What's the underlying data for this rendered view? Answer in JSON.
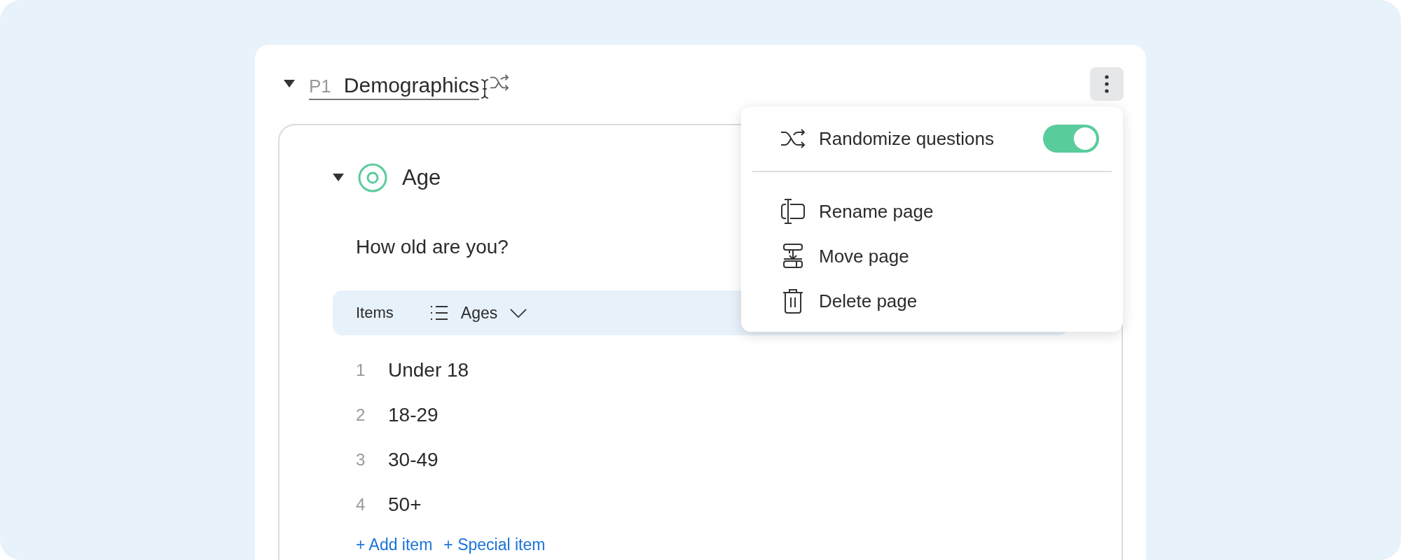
{
  "page": {
    "expanded": true,
    "number": "P1",
    "title": "Demographics",
    "randomized": true
  },
  "menu": {
    "items": [
      {
        "kind": "toggle",
        "label": "Randomize questions",
        "on": true
      },
      {
        "kind": "divider"
      },
      {
        "kind": "rename",
        "label": "Rename page"
      },
      {
        "kind": "move",
        "label": "Move page"
      },
      {
        "kind": "delete",
        "label": "Delete page"
      }
    ]
  },
  "question": {
    "expanded": true,
    "title": "Age",
    "text": "How old are you?",
    "items_bar": {
      "label": "Items",
      "list": "Ages"
    },
    "items": [
      {
        "number": "1",
        "label": "Under 18"
      },
      {
        "number": "2",
        "label": "18-29"
      },
      {
        "number": "3",
        "label": "30-49"
      },
      {
        "number": "4",
        "label": "50+"
      }
    ],
    "links": [
      "+ Add item",
      "+ Special item"
    ]
  }
}
